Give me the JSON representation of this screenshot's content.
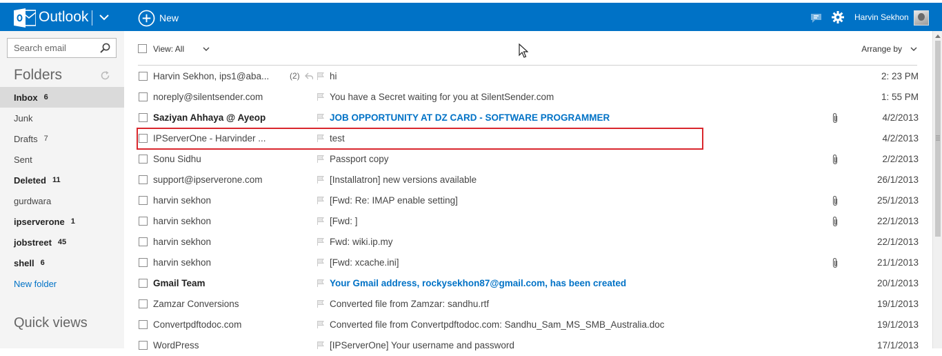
{
  "topbar": {
    "app_name": "Outlook",
    "new_label": "New",
    "user_name": "Harvin Sekhon",
    "brand_color": "#0072c6"
  },
  "sidebar": {
    "search_placeholder": "Search email",
    "folders_heading": "Folders",
    "folders": [
      {
        "name": "Inbox",
        "count": "6",
        "bold": true,
        "selected": true
      },
      {
        "name": "Junk",
        "count": "",
        "bold": false
      },
      {
        "name": "Drafts",
        "count": "7",
        "bold": false
      },
      {
        "name": "Sent",
        "count": "",
        "bold": false
      },
      {
        "name": "Deleted",
        "count": "11",
        "bold": true
      },
      {
        "name": "gurdwara",
        "count": "",
        "bold": false
      },
      {
        "name": "ipserverone",
        "count": "1",
        "bold": true
      },
      {
        "name": "jobstreet",
        "count": "45",
        "bold": true
      },
      {
        "name": "shell",
        "count": "6",
        "bold": true
      }
    ],
    "new_folder_label": "New folder",
    "quick_views_heading": "Quick views"
  },
  "toolbar": {
    "view_label": "View: All",
    "arrange_label": "Arrange by"
  },
  "messages": [
    {
      "sender": "Harvin Sekhon, ips1@aba...",
      "count": "(2)",
      "replied": true,
      "subject": "hi",
      "date": "2: 23 PM",
      "attachment": false,
      "unread": false
    },
    {
      "sender": "noreply@silentsender.com",
      "count": "",
      "replied": false,
      "subject": "You have a Secret waiting for you at SilentSender.com",
      "date": "1: 55 PM",
      "attachment": false,
      "unread": false
    },
    {
      "sender": "Saziyan Ahhaya @ Ayeop",
      "count": "",
      "replied": false,
      "subject": "JOB OPPORTUNITY AT DZ CARD - SOFTWARE PROGRAMMER",
      "date": "4/2/2013",
      "attachment": true,
      "unread": true
    },
    {
      "sender": "IPServerOne - Harvinder ...",
      "count": "",
      "replied": false,
      "subject": "test",
      "date": "4/2/2013",
      "attachment": false,
      "unread": false,
      "highlighted": true
    },
    {
      "sender": "Sonu Sidhu",
      "count": "",
      "replied": false,
      "subject": "Passport copy",
      "date": "2/2/2013",
      "attachment": true,
      "unread": false
    },
    {
      "sender": "support@ipserverone.com",
      "count": "",
      "replied": false,
      "subject": "[Installatron] new versions available",
      "date": "26/1/2013",
      "attachment": false,
      "unread": false
    },
    {
      "sender": "harvin sekhon",
      "count": "",
      "replied": false,
      "subject": "[Fwd: Re: IMAP enable setting]",
      "date": "25/1/2013",
      "attachment": true,
      "unread": false
    },
    {
      "sender": "harvin sekhon",
      "count": "",
      "replied": false,
      "subject": "[Fwd: ]",
      "date": "22/1/2013",
      "attachment": true,
      "unread": false
    },
    {
      "sender": "harvin sekhon",
      "count": "",
      "replied": false,
      "subject": "Fwd: wiki.ip.my",
      "date": "22/1/2013",
      "attachment": false,
      "unread": false
    },
    {
      "sender": "harvin sekhon",
      "count": "",
      "replied": false,
      "subject": "[Fwd: xcache.ini]",
      "date": "21/1/2013",
      "attachment": true,
      "unread": false
    },
    {
      "sender": "Gmail Team",
      "count": "",
      "replied": false,
      "subject": "Your Gmail address, rockysekhon87@gmail.com, has been created",
      "date": "20/1/2013",
      "attachment": false,
      "unread": true
    },
    {
      "sender": "Zamzar Conversions",
      "count": "",
      "replied": false,
      "subject": "Converted file from Zamzar: sandhu.rtf",
      "date": "19/1/2013",
      "attachment": false,
      "unread": false
    },
    {
      "sender": "Convertpdftodoc.com",
      "count": "",
      "replied": false,
      "subject": "Converted file from Convertpdftodoc.com: Sandhu_Sam_MS_SMB_Australia.doc",
      "date": "19/1/2013",
      "attachment": false,
      "unread": false
    },
    {
      "sender": "WordPress",
      "count": "",
      "replied": false,
      "subject": "[IPServerOne] Your username and password",
      "date": "17/1/2013",
      "attachment": false,
      "unread": false
    }
  ]
}
